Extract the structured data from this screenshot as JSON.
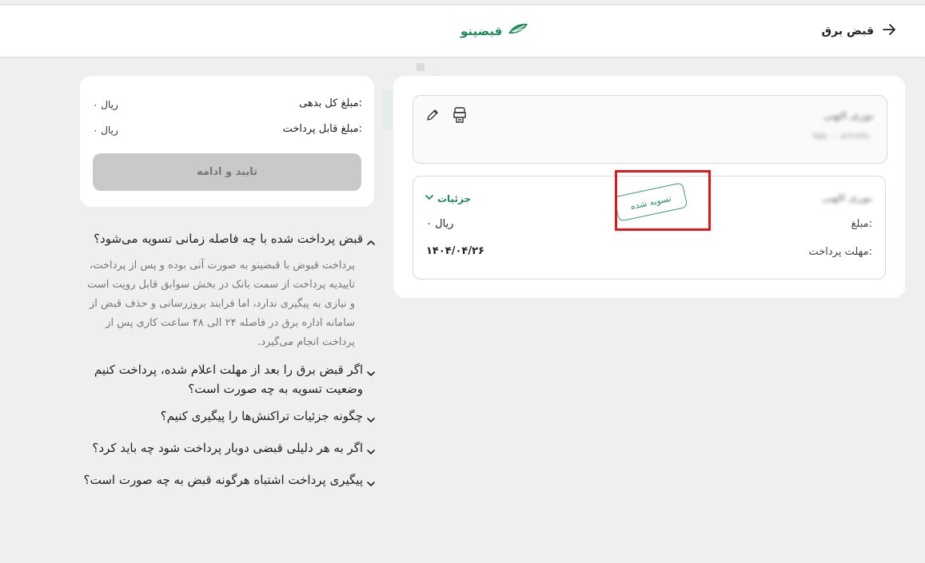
{
  "header": {
    "title": "قبض برق",
    "logo_text": "قبضینو"
  },
  "bill_card": {
    "name": "نوری الهی",
    "bill_id": "۹۵۸۰۰۰۸۲۲۸۳۸۰"
  },
  "payment_card": {
    "name": "نوری الهی",
    "details_label": "جزئیات",
    "stamp_text": "تسویه شده",
    "amount_label": "مبلغ:",
    "amount_value": "۰ ریال",
    "deadline_label": "مهلت پرداخت:",
    "deadline_value": "۱۴۰۴/۰۴/۲۶"
  },
  "summary": {
    "total_debt_label": "مبلغ کل بدهی:",
    "total_debt_value": "۰ ریال",
    "payable_label": "مبلغ قابل پرداخت:",
    "payable_value": "۰ ریال",
    "confirm_label": "تایید و ادامه"
  },
  "faq": [
    {
      "question": "قبض پرداخت شده با چه فاصله زمانی تسویه می‌شود؟",
      "answer": "پرداخت قبوض با قبضینو به صورت آنی بوده و پس از پرداخت، تاییدیه پرداخت از سمت بانک در بخش سوابق قابل رویت است و نیازی به پیگیری ندارد، اما فرایند بروزرسانی و حذف قبض از سامانه اداره برق در فاصله ۲۴ الی ۴۸ ساعت کاری پس از پرداخت انجام می‌گیرد.",
      "expanded": true
    },
    {
      "question": "اگر قبض برق را بعد از مهلت اعلام شده، پرداخت کنیم وضعیت تسویه به چه صورت است؟",
      "expanded": false
    },
    {
      "question": "چگونه جزئیات تراکنش‌ها را پیگیری کنیم؟",
      "expanded": false
    },
    {
      "question": "اگر به هر دلیلی قبضی دوبار پرداخت شود چه باید کرد؟",
      "expanded": false
    },
    {
      "question": "پیگیری پرداخت اشتباه هرگونه قبض به چه صورت است؟",
      "expanded": false
    }
  ],
  "colors": {
    "brand": "#1f8a5a",
    "highlight": "#e0161b",
    "disabled_button": "#c9c9c9"
  }
}
